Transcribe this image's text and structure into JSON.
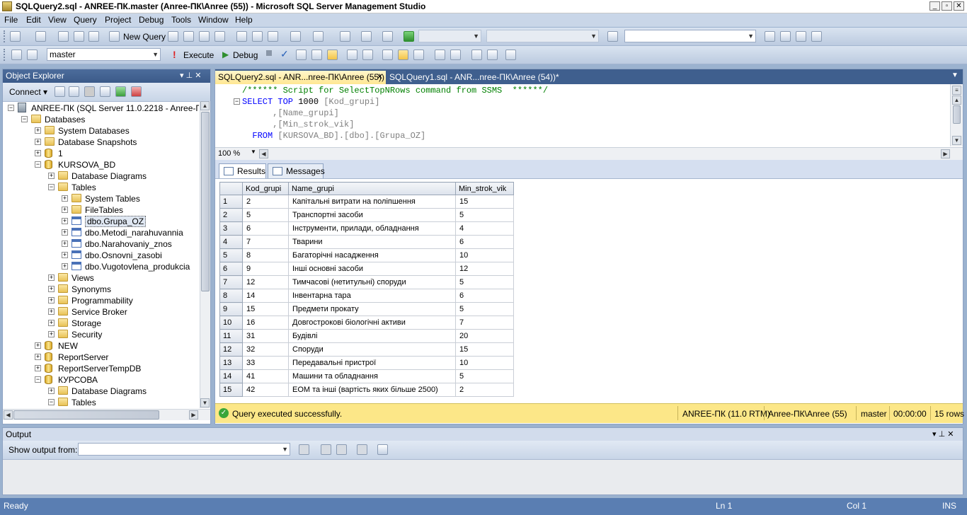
{
  "window": {
    "title": "SQLQuery2.sql - ANREE-ПК.master (Anree-ПК\\Anree (55)) - Microsoft SQL Server Management Studio",
    "minimize": "_",
    "maximize": "▫",
    "close": "✕"
  },
  "menu": [
    "File",
    "Edit",
    "View",
    "Query",
    "Project",
    "Debug",
    "Tools",
    "Window",
    "Help"
  ],
  "toolbar1": {
    "new_query_label": "New Query"
  },
  "toolbar2": {
    "database_value": "master",
    "execute_label": "Execute",
    "debug_label": "Debug"
  },
  "object_explorer": {
    "title": "Object Explorer",
    "pin": "▾ ⊥ ✕",
    "connect_label": "Connect ▾",
    "tree": [
      {
        "label": "ANREE-ПК (SQL Server 11.0.2218 - Anree-ПК\\Anre",
        "depth": 0,
        "expander": "−",
        "icon": "server-icon"
      },
      {
        "label": "Databases",
        "depth": 1,
        "expander": "−",
        "icon": "folder-icon"
      },
      {
        "label": "System Databases",
        "depth": 2,
        "expander": "+",
        "icon": "folder-icon"
      },
      {
        "label": "Database Snapshots",
        "depth": 2,
        "expander": "+",
        "icon": "folder-icon"
      },
      {
        "label": "1",
        "depth": 2,
        "expander": "+",
        "icon": "database-icon"
      },
      {
        "label": "KURSOVA_BD",
        "depth": 2,
        "expander": "−",
        "icon": "database-icon"
      },
      {
        "label": "Database Diagrams",
        "depth": 3,
        "expander": "+",
        "icon": "folder-icon"
      },
      {
        "label": "Tables",
        "depth": 3,
        "expander": "−",
        "icon": "folder-icon"
      },
      {
        "label": "System Tables",
        "depth": 4,
        "expander": "+",
        "icon": "folder-icon"
      },
      {
        "label": "FileTables",
        "depth": 4,
        "expander": "+",
        "icon": "folder-icon"
      },
      {
        "label": "dbo.Grupa_OZ",
        "depth": 4,
        "expander": "+",
        "icon": "table-icon",
        "selected": true
      },
      {
        "label": "dbo.Metodi_narahuvannia",
        "depth": 4,
        "expander": "+",
        "icon": "table-icon"
      },
      {
        "label": "dbo.Narahovaniy_znos",
        "depth": 4,
        "expander": "+",
        "icon": "table-icon"
      },
      {
        "label": "dbo.Osnovni_zasobi",
        "depth": 4,
        "expander": "+",
        "icon": "table-icon"
      },
      {
        "label": "dbo.Vugotovlena_produkcia",
        "depth": 4,
        "expander": "+",
        "icon": "table-icon"
      },
      {
        "label": "Views",
        "depth": 3,
        "expander": "+",
        "icon": "folder-icon"
      },
      {
        "label": "Synonyms",
        "depth": 3,
        "expander": "+",
        "icon": "folder-icon"
      },
      {
        "label": "Programmability",
        "depth": 3,
        "expander": "+",
        "icon": "folder-icon"
      },
      {
        "label": "Service Broker",
        "depth": 3,
        "expander": "+",
        "icon": "folder-icon"
      },
      {
        "label": "Storage",
        "depth": 3,
        "expander": "+",
        "icon": "folder-icon"
      },
      {
        "label": "Security",
        "depth": 3,
        "expander": "+",
        "icon": "folder-icon"
      },
      {
        "label": "NEW",
        "depth": 2,
        "expander": "+",
        "icon": "database-icon"
      },
      {
        "label": "ReportServer",
        "depth": 2,
        "expander": "+",
        "icon": "database-icon"
      },
      {
        "label": "ReportServerTempDB",
        "depth": 2,
        "expander": "+",
        "icon": "database-icon"
      },
      {
        "label": "КУРСОВА",
        "depth": 2,
        "expander": "−",
        "icon": "database-icon"
      },
      {
        "label": "Database Diagrams",
        "depth": 3,
        "expander": "+",
        "icon": "folder-icon"
      },
      {
        "label": "Tables",
        "depth": 3,
        "expander": "−",
        "icon": "folder-icon"
      }
    ]
  },
  "tabs": [
    {
      "label": "SQLQuery2.sql - ANR...nree-ПК\\Anree (55))",
      "close": "✕",
      "active": true
    },
    {
      "label": "SQLQuery1.sql - ANR...nree-ПК\\Anree (54))*",
      "active": false
    }
  ],
  "editor": {
    "line1": "/****** Script for SelectTopNRows command from SSMS  ******/",
    "line2_kw": "SELECT TOP",
    "line2_num": " 1000 ",
    "line2_id": "[Kod_grupi]",
    "line3": "      ,[Name_grupi]",
    "line4": "      ,[Min_strok_vik]",
    "line5_kw": "  FROM ",
    "line5_id": "[KURSOVA_BD].[dbo].[Grupa_OZ]",
    "zoom": "100 %"
  },
  "results": {
    "tab_results": "Results",
    "tab_messages": "Messages",
    "columns": [
      "Kod_grupi",
      "Name_grupi",
      "Min_strok_vik"
    ],
    "rows": [
      [
        "1",
        "2",
        "Капітальні витрати на поліпшення",
        "15"
      ],
      [
        "2",
        "5",
        "Транспортні засоби",
        "5"
      ],
      [
        "3",
        "6",
        "Інструменти, прилади, обладнання",
        "4"
      ],
      [
        "4",
        "7",
        "Тварини",
        "6"
      ],
      [
        "5",
        "8",
        "Багаторічні насадження",
        "10"
      ],
      [
        "6",
        "9",
        "Інші основні засоби",
        "12"
      ],
      [
        "7",
        "12",
        "Тимчасові (нетитульні) споруди",
        "5"
      ],
      [
        "8",
        "14",
        "Інвентарна тара",
        "6"
      ],
      [
        "9",
        "15",
        "Предмети прокату",
        "5"
      ],
      [
        "10",
        "16",
        "Довгострокові біологічні активи",
        "7"
      ],
      [
        "11",
        "31",
        "Будівлі",
        "20"
      ],
      [
        "12",
        "32",
        "Споруди",
        "15"
      ],
      [
        "13",
        "33",
        "Передавальні пристрої",
        "10"
      ],
      [
        "14",
        "41",
        "Машини та обладнання",
        "5"
      ],
      [
        "15",
        "42",
        "ЕОМ та інші (вартість яких більше 2500)",
        "2"
      ]
    ]
  },
  "query_status": {
    "icon": "✓",
    "message": "Query executed successfully.",
    "server": "ANREE-ПК (11.0 RTM)",
    "user": "Anree-ПК\\Anree (55)",
    "database": "master",
    "elapsed": "00:00:00",
    "rows": "15 rows"
  },
  "output": {
    "title": "Output",
    "controls": "▾ ⊥ ✕",
    "show_output_from": "Show output from:"
  },
  "status_bar": {
    "ready": "Ready",
    "ln": "Ln 1",
    "col": "Col 1",
    "mode": "INS"
  }
}
